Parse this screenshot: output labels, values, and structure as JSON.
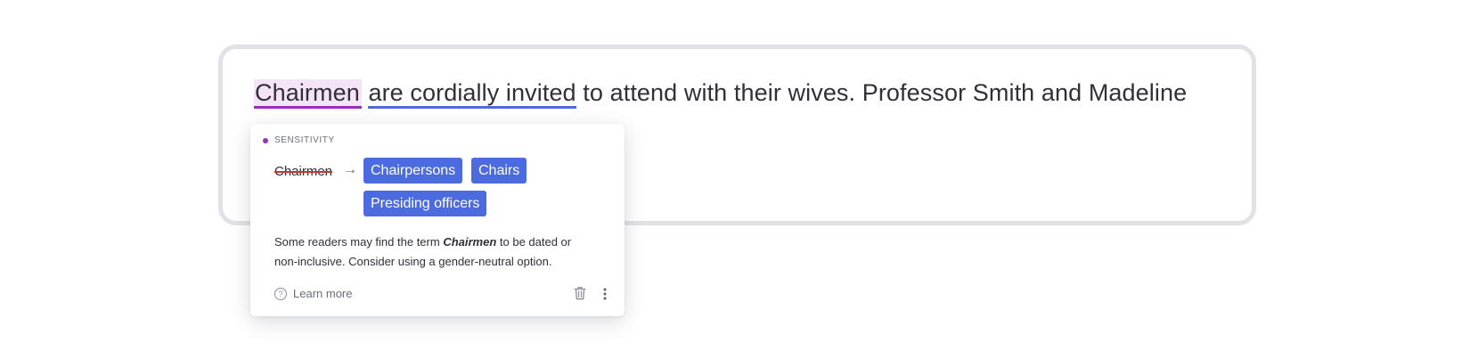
{
  "editor": {
    "flagged_word": "Chairmen",
    "space1": " ",
    "clarity_phrase": "are cordially invited",
    "rest_text": " to attend with their wives. Professor Smith and Madeline"
  },
  "card": {
    "category": "SENSITIVITY",
    "original": "Chairmen",
    "arrow": "→",
    "suggestions": [
      "Chairpersons",
      "Chairs",
      "Presiding officers"
    ],
    "explanation_before": "Some readers may find the term ",
    "explanation_term": "Chairmen",
    "explanation_after": " to be dated or non-inclusive. Consider using a gender-neutral option.",
    "learn_more": "Learn more",
    "help_glyph": "?"
  },
  "colors": {
    "sensitivity": "#9b2dbd",
    "suggestion_chip": "#4b6bde",
    "clarity_underline": "#4b6bde"
  }
}
